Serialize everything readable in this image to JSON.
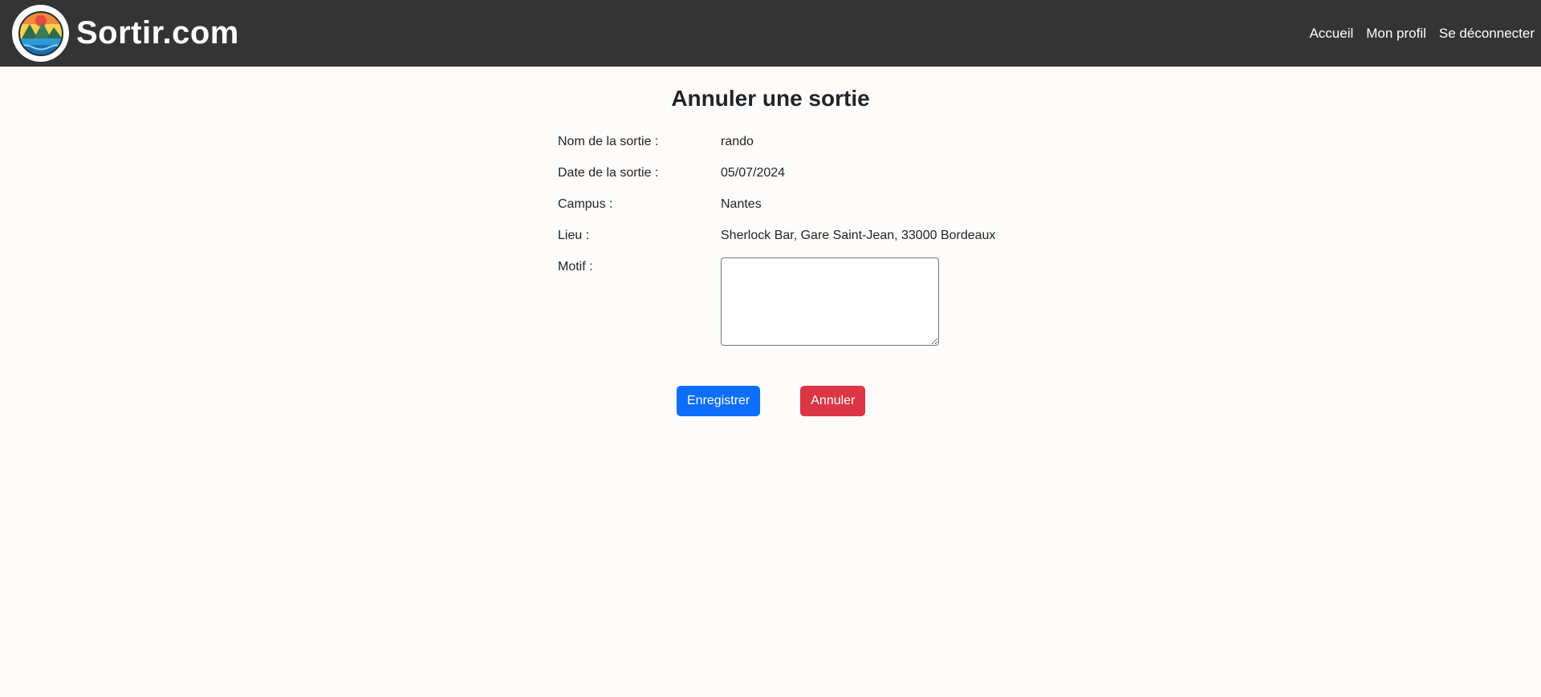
{
  "navbar": {
    "brand": "Sortir.com",
    "links": [
      "Accueil",
      "Mon profil",
      "Se déconnecter"
    ]
  },
  "page": {
    "title": "Annuler une sortie"
  },
  "form": {
    "fields": [
      {
        "label": "Nom de la sortie :",
        "value": "rando"
      },
      {
        "label": "Date de la sortie :",
        "value": "05/07/2024"
      },
      {
        "label": "Campus :",
        "value": "Nantes"
      },
      {
        "label": "Lieu :",
        "value": "Sherlock Bar, Gare Saint-Jean, 33000 Bordeaux"
      }
    ],
    "motif_label": "Motif :",
    "motif_value": ""
  },
  "buttons": {
    "save": "Enregistrer",
    "cancel": "Annuler"
  },
  "colors": {
    "navbar_bg": "#343434",
    "primary": "#0d6efd",
    "danger": "#dc3545",
    "page_bg": "#fdfcfa"
  }
}
